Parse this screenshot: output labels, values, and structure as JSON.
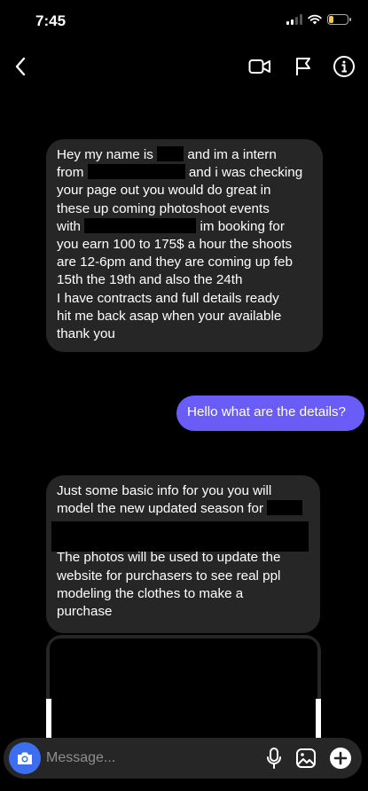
{
  "status_bar": {
    "time": "7:45",
    "battery_level": 0.25,
    "battery_color": "#f2c94c"
  },
  "nav": {
    "back_icon": "chevron-left-icon",
    "video_icon": "video-camera-icon",
    "report_icon": "flag-icon",
    "info_icon": "info-icon"
  },
  "messages": {
    "m1": {
      "a": "Hey my name is",
      "b": "and im a intern",
      "c": "from",
      "d": "and i was checking",
      "e": "your page out you would do great in",
      "f": "these up coming photoshoot events",
      "g": "with",
      "h": "im booking for",
      "i": "you earn 100 to 175$ a hour the shoots",
      "j": "are 12-6pm and they are coming up feb",
      "k": "15th the 19th and also the 24th",
      "l": "I have contracts and full details ready",
      "m": "hit me back asap when your available",
      "n": "thank you"
    },
    "m2": {
      "text": "Hello what are the details?"
    },
    "m3": {
      "a": "Just some basic info for you you will",
      "b": "model the new updated season for",
      "c": "The photos will be used to update the",
      "d": "website for purchasers to see real ppl",
      "e": "modeling the clothes to make a",
      "f": "purchase"
    }
  },
  "composer": {
    "placeholder": "Message...",
    "camera_icon": "camera-icon",
    "mic_icon": "microphone-icon",
    "gallery_icon": "gallery-icon",
    "add_icon": "plus-circle-icon"
  },
  "colors": {
    "background": "#000000",
    "incoming_bubble": "#262626",
    "outgoing_bubble": "#6a5cf6",
    "camera_button": "#3d6ef0"
  }
}
